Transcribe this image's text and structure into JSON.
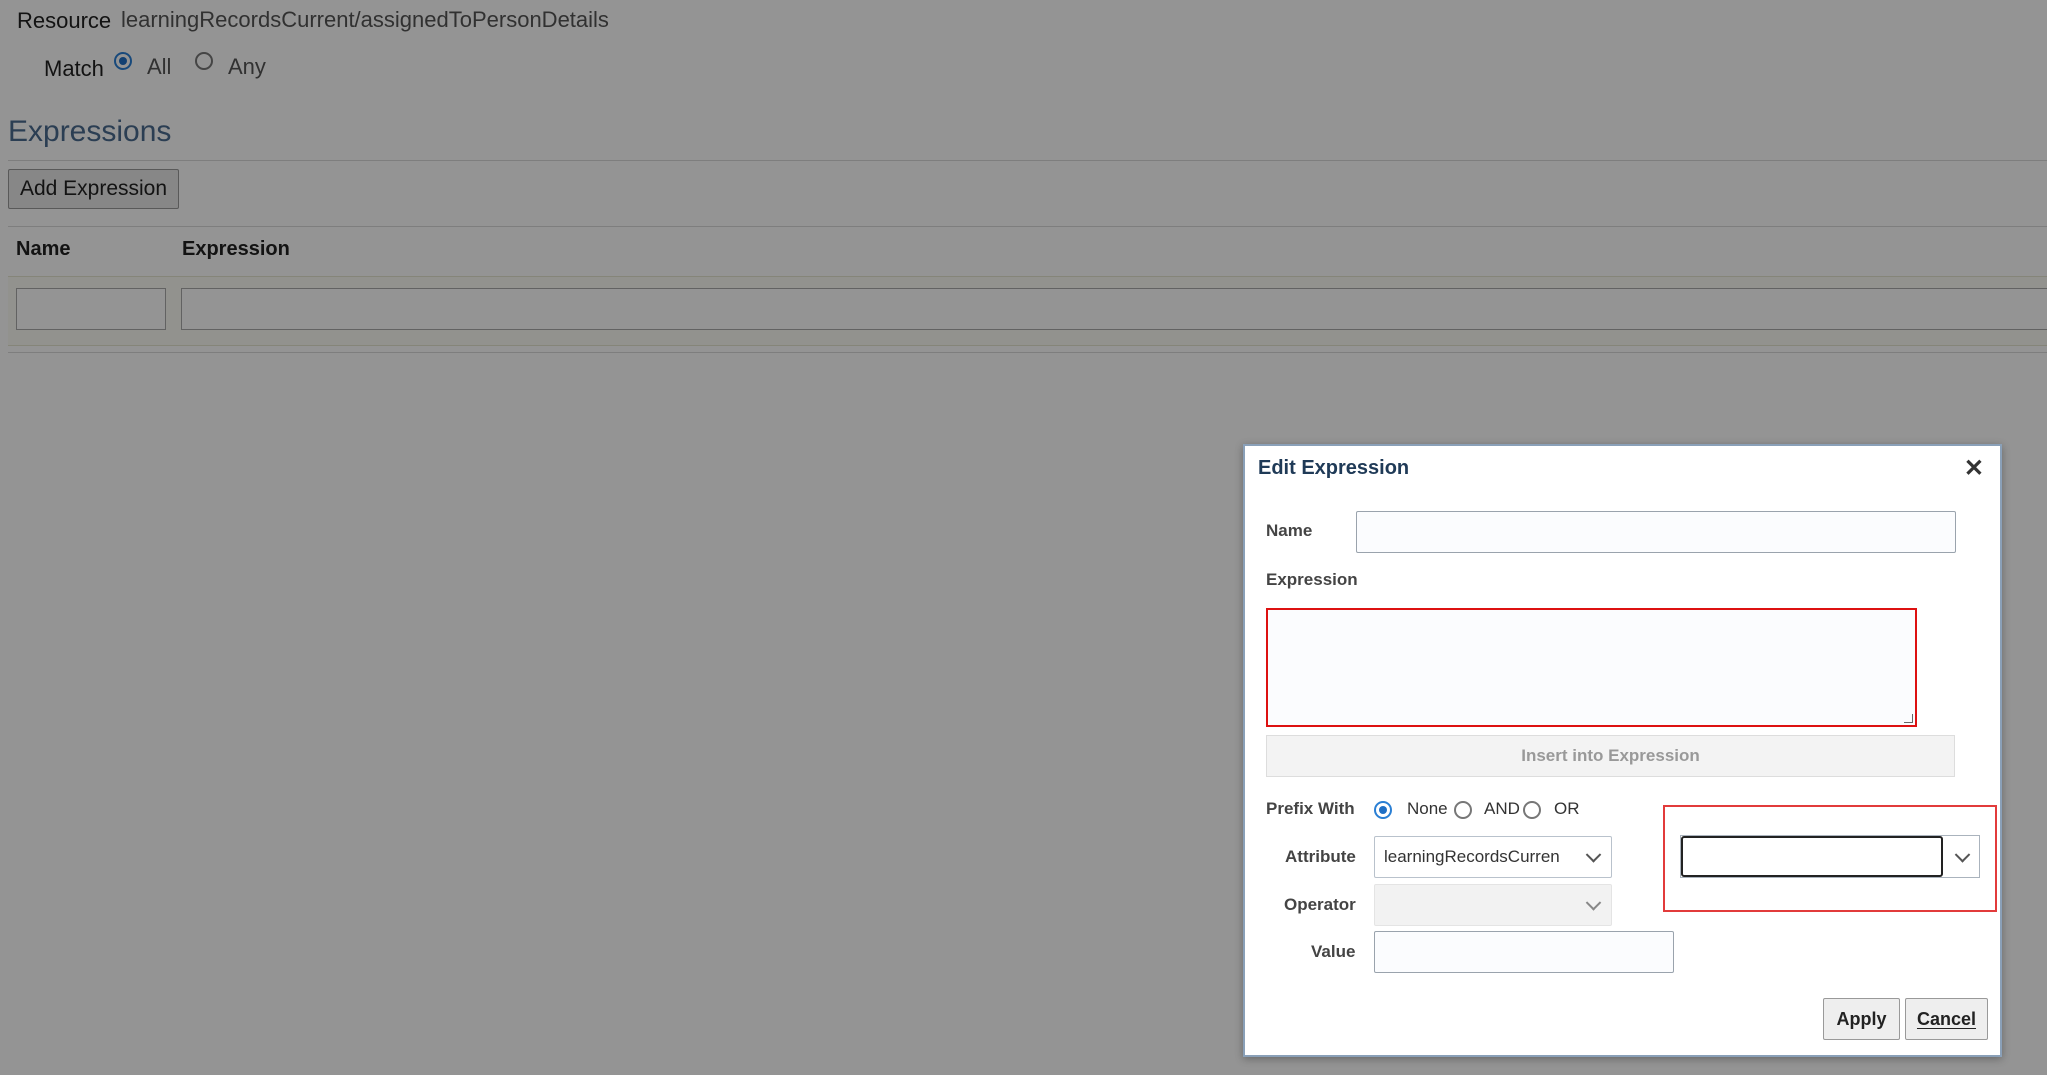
{
  "resource": {
    "label": "Resource",
    "value": "learningRecordsCurrent/assignedToPersonDetails"
  },
  "match": {
    "label": "Match",
    "options": [
      {
        "label": "All",
        "selected": true
      },
      {
        "label": "Any",
        "selected": false
      }
    ]
  },
  "expressions": {
    "heading": "Expressions",
    "add_button": "Add Expression",
    "columns": [
      "Name",
      "Expression"
    ],
    "row": {
      "name": "",
      "expression": ""
    }
  },
  "dialog": {
    "title": "Edit Expression",
    "close_icon": "close-icon",
    "name_label": "Name",
    "name_value": "",
    "expression_label": "Expression",
    "expression_value": "",
    "insert_button": "Insert into Expression",
    "prefix_label": "Prefix With",
    "prefix_options": [
      {
        "label": "None",
        "selected": true
      },
      {
        "label": "AND",
        "selected": false
      },
      {
        "label": "OR",
        "selected": false
      }
    ],
    "attribute_label": "Attribute",
    "attribute_value": "learningRecordsCurren",
    "operator_label": "Operator",
    "operator_value": "",
    "value_label": "Value",
    "value_value": "",
    "sub_attribute_value": "",
    "apply_button": "Apply",
    "cancel_button": "Cancel"
  },
  "colors": {
    "overlay": "#000000",
    "highlight_red": "#e23b3b",
    "required_red": "#dd1111",
    "radio_blue": "#1f6fc5",
    "title_blue": "#1f3a57"
  }
}
